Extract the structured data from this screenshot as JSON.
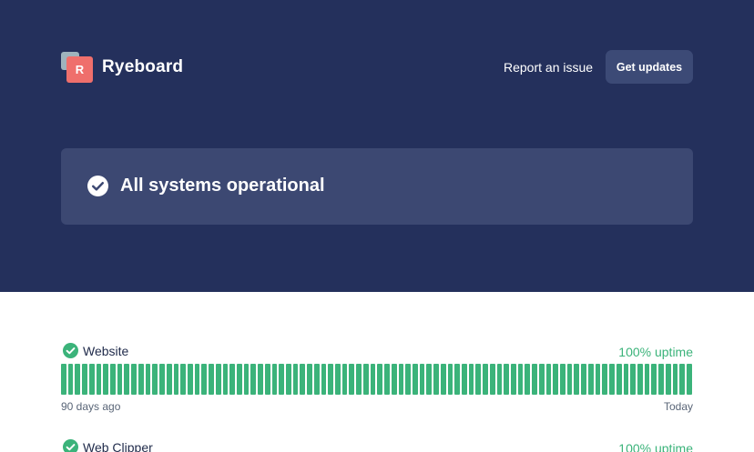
{
  "brand": {
    "initial": "R",
    "name": "Ryeboard"
  },
  "header": {
    "report_label": "Report an issue",
    "updates_label": "Get updates"
  },
  "status": {
    "text": "All systems operational"
  },
  "components": [
    {
      "name": "Website",
      "uptime": "100% uptime",
      "days": 90,
      "left_label": "90 days ago",
      "right_label": "Today"
    },
    {
      "name": "Web Clipper",
      "uptime": "100% uptime"
    }
  ],
  "colors": {
    "hero_bg": "#24305c",
    "banner_bg": "#3c4872",
    "button_bg": "#3c4a76",
    "uptime_green": "#3bb37a",
    "logo_red": "#ef6f6c",
    "logo_grey": "#9fb3bd"
  }
}
